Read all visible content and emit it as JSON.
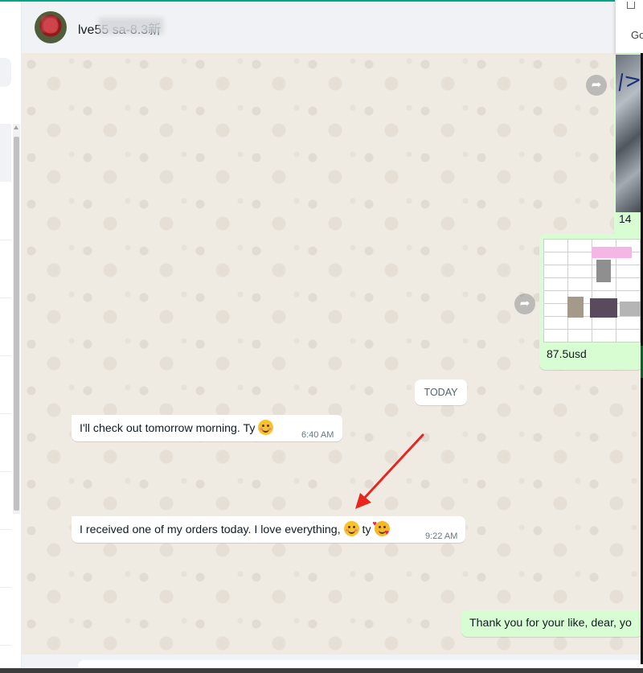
{
  "header": {
    "contact_name": "lve5⁠5  sa-8.3新"
  },
  "browser_panel": {
    "text": "Go"
  },
  "messages": {
    "m1_caption": "14",
    "m2_caption": "87.5usd",
    "date_divider": "TODAY",
    "m3": {
      "text": "I'll check out tomorrow morning. Ty",
      "time": "6:40 AM"
    },
    "m4": {
      "text": "I received one of my orders today. I love everything,",
      "text_after": "ty",
      "time": "9:22 AM"
    },
    "m5": {
      "text": "Thank you for your like, dear, yo"
    }
  },
  "icons": {
    "forward": "forward-arrow-icon",
    "smile_emoji": "smiling-face-emoji",
    "hearts_emoji": "smiling-face-with-hearts-emoji"
  },
  "colors": {
    "accent": "#00a884",
    "incoming_bubble": "#ffffff",
    "outgoing_bubble": "#d9fdd3",
    "chat_bg": "#efeae2",
    "annotation_arrow": "#e8251f"
  }
}
